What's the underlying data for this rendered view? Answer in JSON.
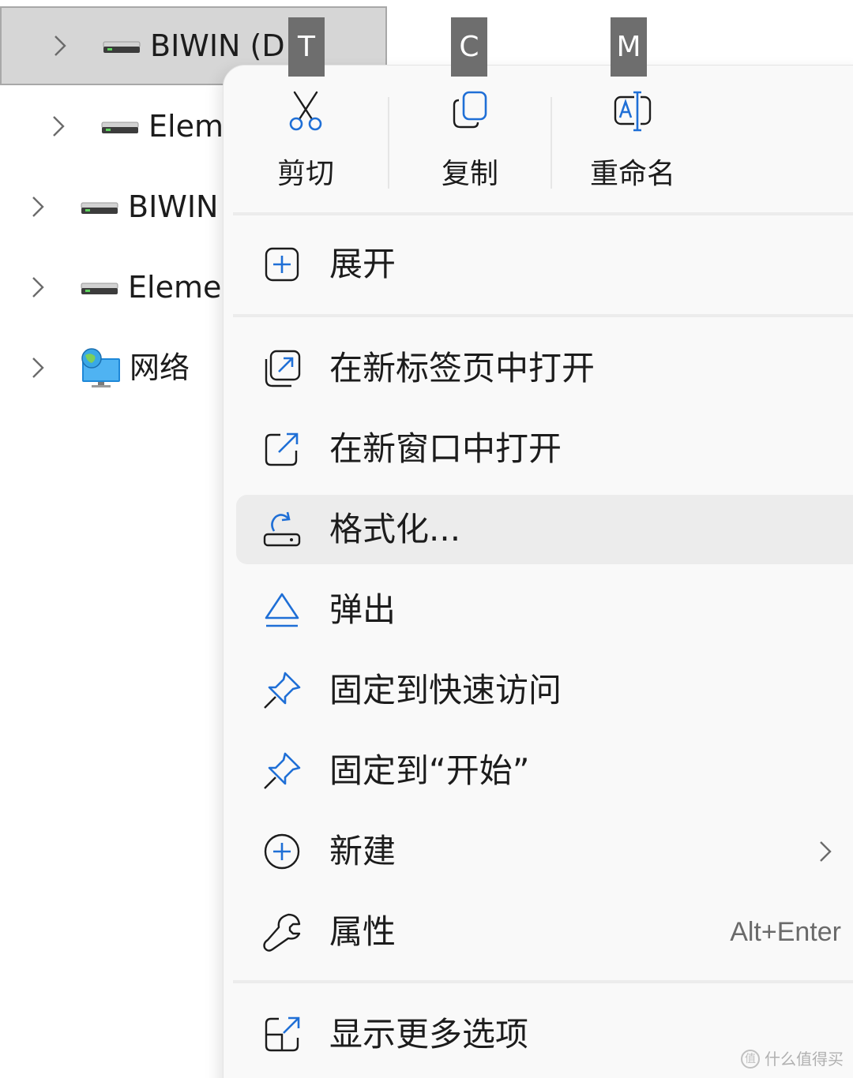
{
  "tree": {
    "items": [
      {
        "label": "BIWIN (D:",
        "icon": "drive-icon",
        "selected": true
      },
      {
        "label": "Elem",
        "icon": "drive-icon"
      },
      {
        "label": "BIWIN",
        "icon": "drive-icon"
      },
      {
        "label": "Eleme",
        "icon": "drive-icon"
      },
      {
        "label": "网络",
        "icon": "network-icon"
      }
    ]
  },
  "keytips": {
    "cut": "T",
    "copy": "C",
    "rename": "M"
  },
  "menu": {
    "actions": {
      "cut": "剪切",
      "copy": "复制",
      "rename": "重命名"
    },
    "expand": "展开",
    "open_new_tab": "在新标签页中打开",
    "open_new_window": "在新窗口中打开",
    "format": "格式化...",
    "eject": "弹出",
    "pin_quick_access": "固定到快速访问",
    "pin_start": "固定到“开始”",
    "new": "新建",
    "properties": "属性",
    "properties_shortcut": "Alt+Enter",
    "show_more": "显示更多选项"
  },
  "watermark": {
    "text": "什么值得买"
  },
  "colors": {
    "accent": "#1f6fd6",
    "selected_bg": "#d6d6d6",
    "hover_bg": "#ececec"
  }
}
